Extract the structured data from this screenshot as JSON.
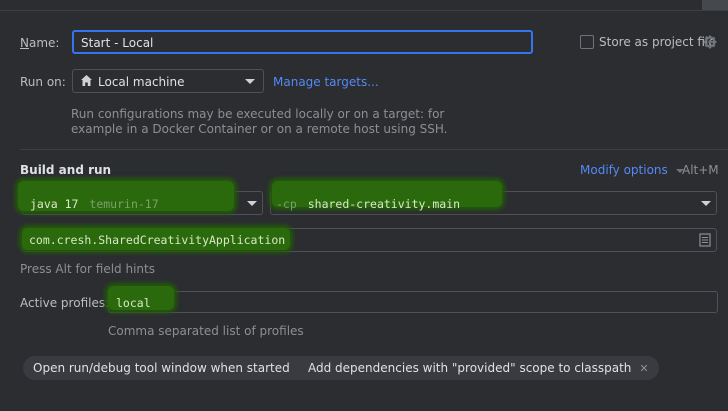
{
  "name": {
    "label": "Name:",
    "label_mnemonic": "N",
    "label_rest": "ame:",
    "value": "Start - Local"
  },
  "store_project_file": {
    "label": "Store as project file",
    "checked": false,
    "icon": "gear-icon"
  },
  "run_on": {
    "label": "Run on:",
    "target": "Local machine",
    "target_icon": "home-icon",
    "manage_link": "Manage targets..."
  },
  "run_on_description": {
    "line1": "Run configurations may be executed locally or on a target: for",
    "line2": "example in a Docker Container or on a remote host using SSH."
  },
  "build_and_run": {
    "heading": "Build and run",
    "modify_options": "Modify options",
    "modify_shortcut": "Alt+M",
    "jre": {
      "name": "java 17",
      "detail": "temurin-17"
    },
    "classpath": {
      "flag": "-cp",
      "module": "shared-creativity.main"
    },
    "main_class": "com.cresh.SharedCreativityApplication",
    "field_hint": "Press Alt for field hints"
  },
  "active_profiles": {
    "label": "Active profiles:",
    "value": "local",
    "hint": "Comma separated list of profiles"
  },
  "chips": [
    {
      "label": "Open run/debug tool window when started"
    },
    {
      "label": "Add dependencies with \"provided\" scope to classpath"
    }
  ],
  "colors": {
    "background": "#2b2d30",
    "accent": "#3574f0",
    "link": "#548af7",
    "highlight": "#2a6a0c"
  }
}
